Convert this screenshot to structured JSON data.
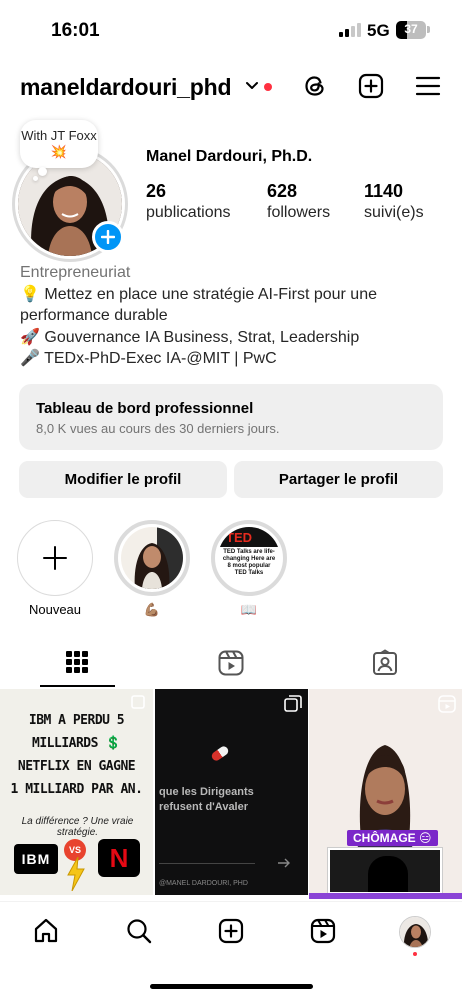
{
  "status_bar": {
    "time": "16:01",
    "network": "5G",
    "battery": "37",
    "battery_level_percent": 37
  },
  "header": {
    "username": "maneldardouri_phd",
    "icons": [
      "chevron-down-icon",
      "threads-icon",
      "create-icon",
      "menu-icon"
    ]
  },
  "profile": {
    "note_text": "With JT Foxx 💥",
    "full_name": "Manel Dardouri, Ph.D.",
    "stats": [
      {
        "value": "26",
        "label": "publications"
      },
      {
        "value": "628",
        "label": "followers"
      },
      {
        "value": "1140",
        "label": "suivi(e)s"
      }
    ],
    "bio": {
      "category": "Entrepreneuriat",
      "lines": [
        "💡 Mettez en place une stratégie AI-First pour une performance durable",
        "🚀 Gouvernance IA Business, Strat, Leadership",
        "🎤 TEDx-PhD-Exec IA-@MIT | PwC"
      ]
    }
  },
  "dashboard": {
    "title": "Tableau de bord professionnel",
    "subtitle": "8,0 K vues au cours des 30 derniers jours."
  },
  "buttons": {
    "edit_profile": "Modifier le profil",
    "share_profile": "Partager le profil"
  },
  "highlights": [
    {
      "label": "Nouveau"
    },
    {
      "label": "💪🏽"
    },
    {
      "label": "📖"
    }
  ],
  "highlight_thumb_text": "TED Talks are life-changing Here are 8 most popular TED Talks",
  "tabs": [
    "grid-icon",
    "reels-icon",
    "tagged-icon"
  ],
  "posts": [
    {
      "title_lines": [
        "IBM A PERDU 5",
        "MILLIARDS 💲",
        "NETFLIX EN GAGNE",
        "1 MILLIARD PAR AN."
      ],
      "subtitle": "La différence ? Une vraie stratégie.",
      "logos": [
        "IBM",
        "VS",
        "N"
      ]
    },
    {
      "text_lines": [
        "que les Dirigeants",
        "refusent d'Avaler"
      ],
      "handle": "@MANEL DARDOURI, PHD"
    },
    {
      "badge": "CHÔMAGE 😑",
      "progress_fraction": 1.0
    }
  ],
  "colors": {
    "accent_blue": "#0095f6",
    "notification_red": "#ff3040",
    "button_bg": "#efefef",
    "reel_purple": "#7b27c9"
  }
}
